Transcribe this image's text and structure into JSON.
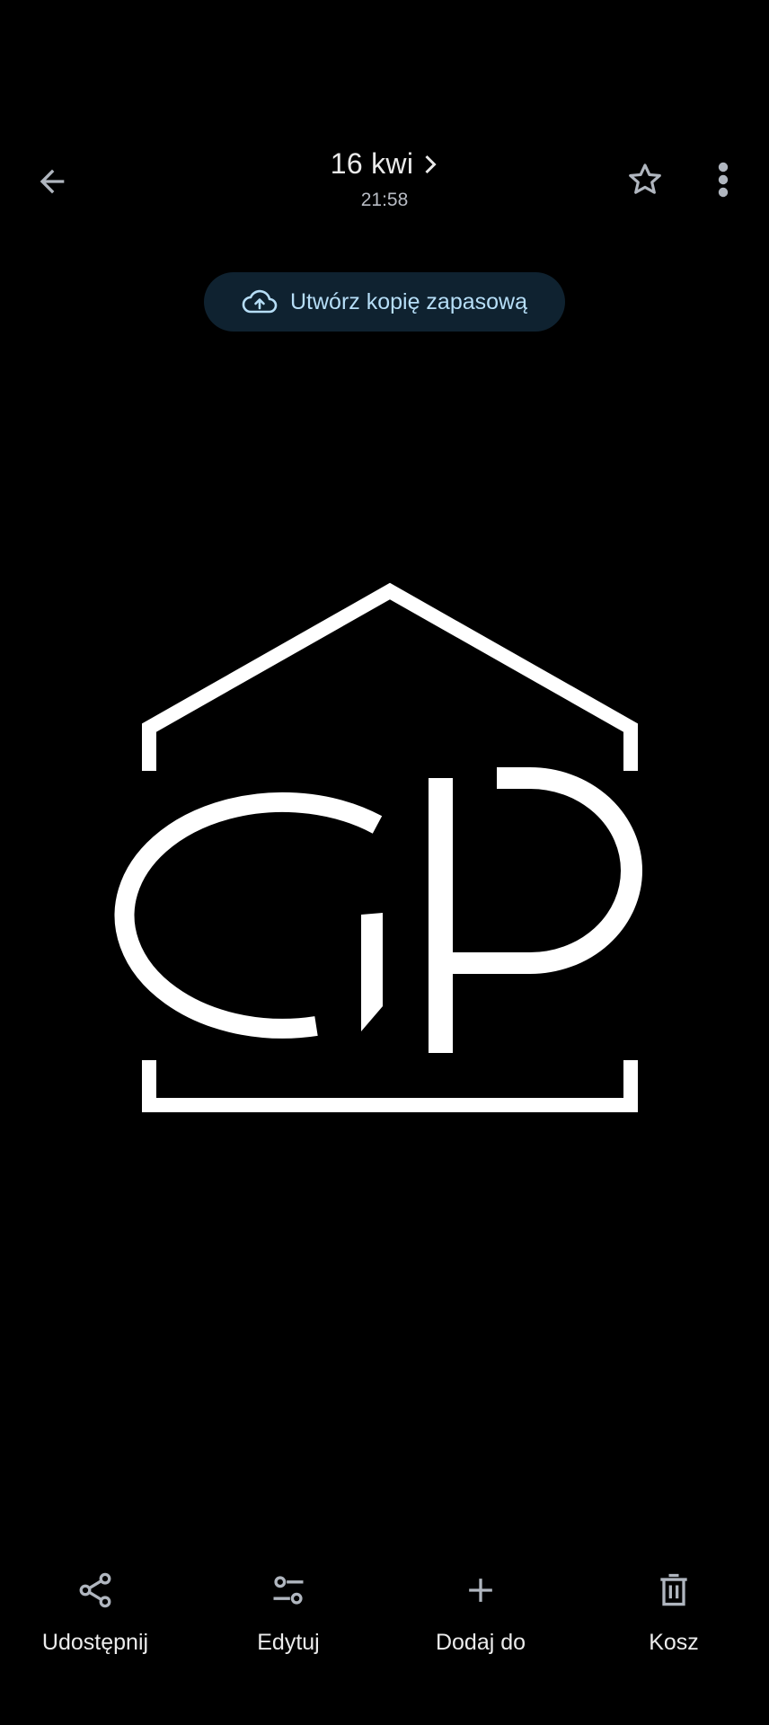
{
  "header": {
    "date": "16 kwi",
    "time": "21:58",
    "back_icon": "arrow-back-icon",
    "star_icon": "star-outline-icon",
    "more_icon": "more-vert-icon"
  },
  "backup": {
    "label": "Utwórz kopię zapasową",
    "icon": "cloud-upload-icon"
  },
  "photo": {
    "description_icon": "gp-house-logo"
  },
  "actions": [
    {
      "label": "Udostępnij",
      "icon": "share-icon"
    },
    {
      "label": "Edytuj",
      "icon": "tune-icon"
    },
    {
      "label": "Dodaj do",
      "icon": "plus-icon"
    },
    {
      "label": "Kosz",
      "icon": "trash-icon"
    }
  ],
  "colors": {
    "background": "#000000",
    "chip_background": "#0f2230",
    "chip_text": "#b6def7",
    "icon_gray": "#b0b6bf",
    "logo_white": "#ffffff"
  }
}
